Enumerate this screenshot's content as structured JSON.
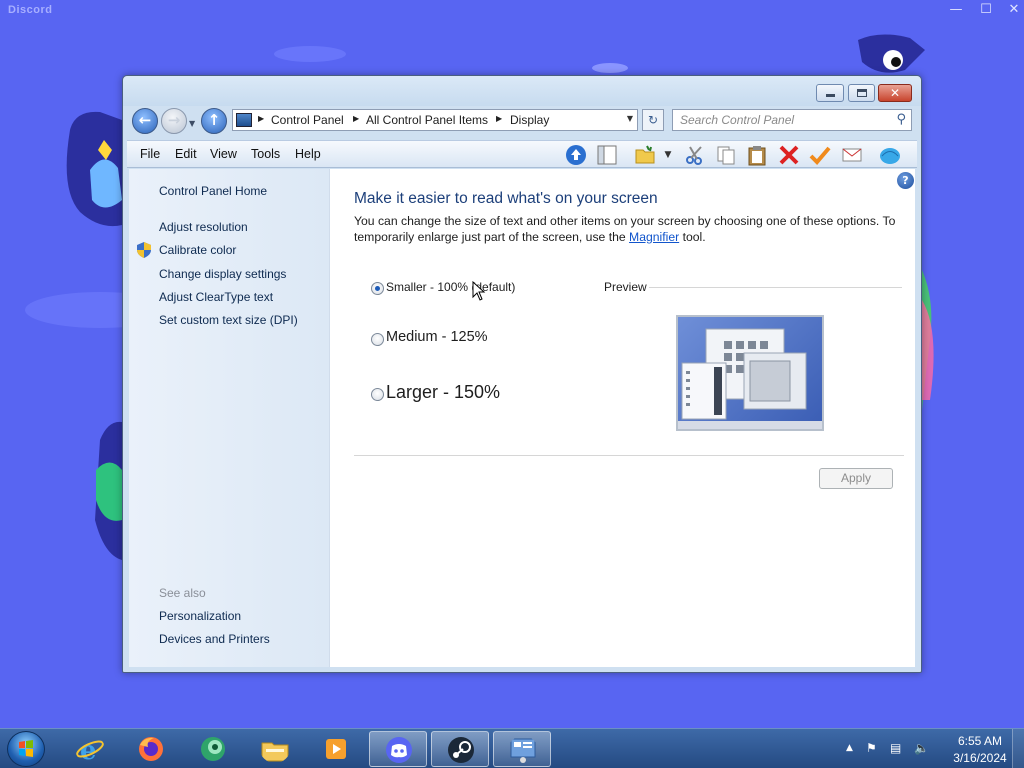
{
  "discord": {
    "title": "Discord",
    "controls": {
      "minimize": "—",
      "maximize": "☐",
      "close": "✕"
    }
  },
  "window": {
    "caption": {
      "minimize": "minimize",
      "maximize": "maximize",
      "close": "✕"
    },
    "address": {
      "crumbs": [
        "Control Panel",
        "All Control Panel Items",
        "Display"
      ]
    },
    "search": {
      "placeholder": "Search Control Panel"
    },
    "menu": [
      "File",
      "Edit",
      "View",
      "Tools",
      "Help"
    ],
    "toolbar_icons": [
      "up-icon",
      "panel-icon",
      "folder-icon",
      "cut-icon",
      "copy-icon",
      "paste-icon",
      "delete-icon",
      "check-icon",
      "email-icon",
      "shell-icon"
    ]
  },
  "sidebar": {
    "home": "Control Panel Home",
    "items": [
      {
        "label": "Adjust resolution"
      },
      {
        "label": "Calibrate color"
      },
      {
        "label": "Change display settings"
      },
      {
        "label": "Adjust ClearType text"
      },
      {
        "label": "Set custom text size (DPI)"
      }
    ],
    "see_also": "See also",
    "see_also_items": [
      {
        "label": "Personalization"
      },
      {
        "label": "Devices and Printers"
      }
    ]
  },
  "main": {
    "title": "Make it easier to read what's on your screen",
    "desc_before": "You can change the size of text and other items on your screen by choosing one of these options. To temporarily enlarge just part of the screen, use the",
    "desc_link": "Magnifier",
    "desc_after": "tool.",
    "options": [
      {
        "label": "Smaller - 100% (default)",
        "checked": true
      },
      {
        "label": "Medium - 125%",
        "checked": false
      },
      {
        "label": "Larger - 150%",
        "checked": false
      }
    ],
    "preview_label": "Preview",
    "apply_label": "Apply",
    "help": "?"
  },
  "taskbar": {
    "apps": [
      "internet-explorer-icon",
      "firefox-icon",
      "app-icon",
      "file-explorer-icon",
      "media-player-icon",
      "discord-icon",
      "steam-icon",
      "control-panel-icon"
    ],
    "clock": {
      "time": "6:55 AM",
      "date": "3/16/2024"
    }
  }
}
